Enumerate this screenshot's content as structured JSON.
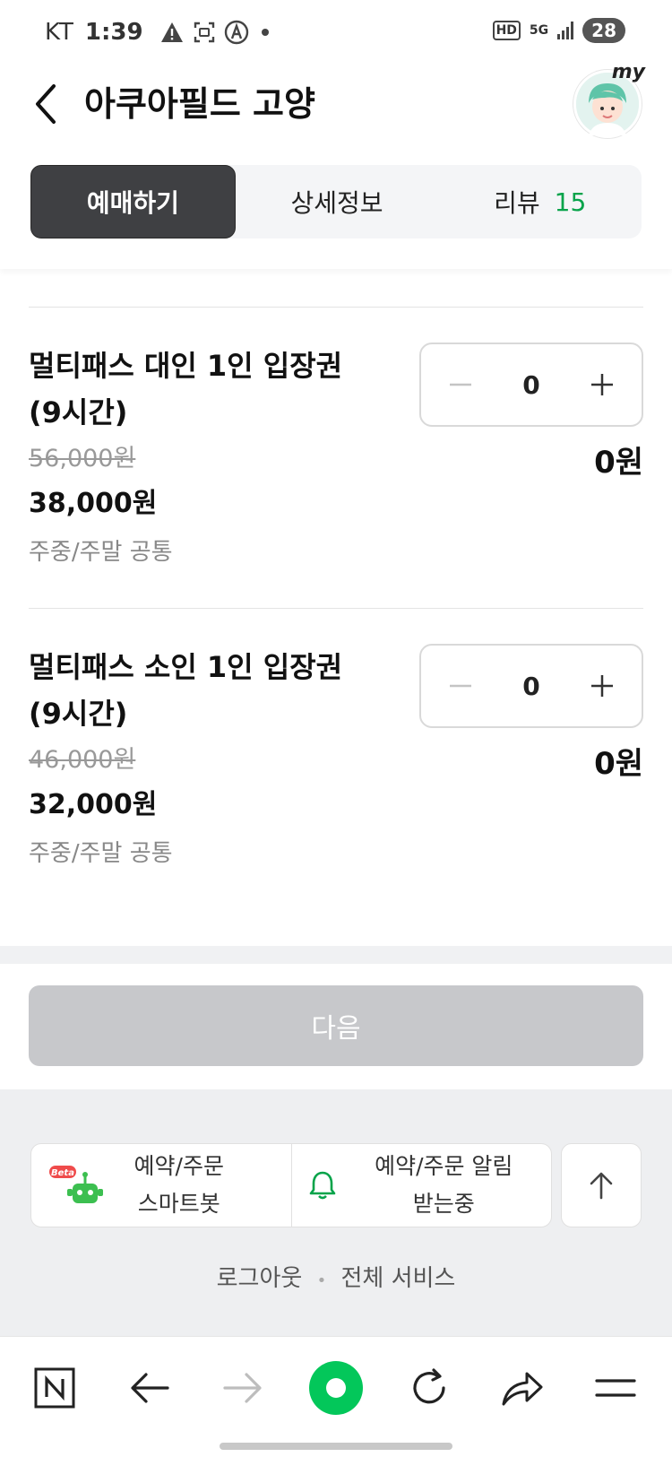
{
  "status_bar": {
    "carrier": "KT",
    "time": "1:39",
    "hd_label": "HD",
    "network_label": "5G",
    "battery": "28"
  },
  "header": {
    "title": "아쿠아필드 고양",
    "my_label": "my"
  },
  "tabs": [
    {
      "label": "예매하기",
      "active": true
    },
    {
      "label": "상세정보",
      "active": false
    },
    {
      "label": "리뷰",
      "count": "15",
      "active": false
    }
  ],
  "tickets": [
    {
      "name": "멀티패스 대인 1인 입장권 (9시간)",
      "original_price": "56,000원",
      "sale_price": "38,000원",
      "note": "주중/주말 공통",
      "quantity": "0",
      "total": "0원"
    },
    {
      "name": "멀티패스 소인 1인 입장권 (9시간)",
      "original_price": "46,000원",
      "sale_price": "32,000원",
      "note": "주중/주말 공통",
      "quantity": "0",
      "total": "0원"
    }
  ],
  "next_button": "다음",
  "footer": {
    "bot_badge": "Beta",
    "bot_line1": "예약/주문",
    "bot_line2": "스마트봇",
    "alert_line1": "예약/주문 알림",
    "alert_line2": "받는중",
    "links": [
      "로그아웃",
      "전체 서비스"
    ]
  },
  "colors": {
    "accent_green": "#06a34a",
    "active_tab": "#3f4043",
    "disabled_button": "#c7c8cb",
    "browser_green": "#03c75a"
  }
}
